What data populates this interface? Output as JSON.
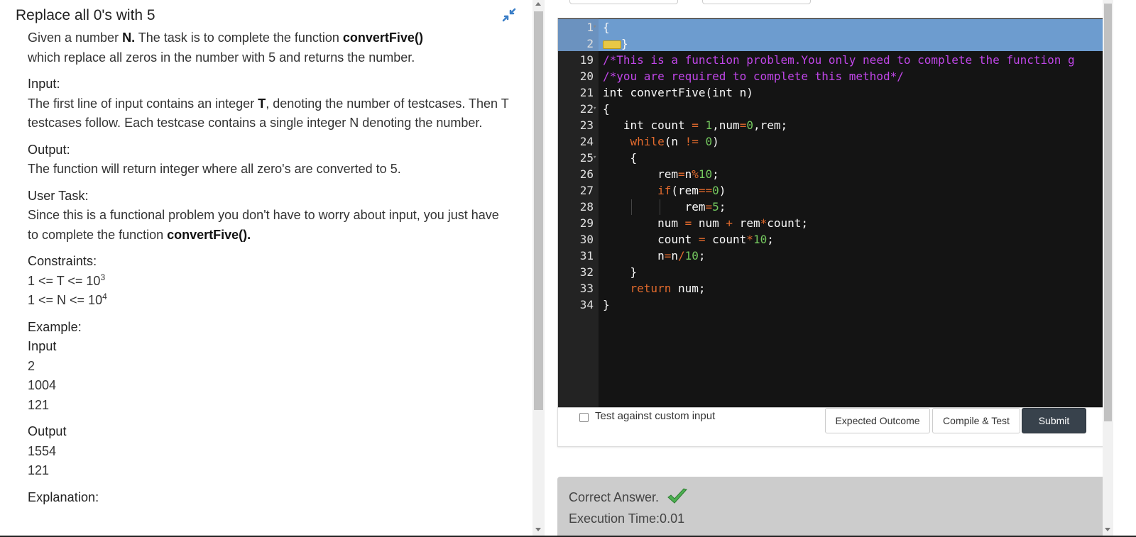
{
  "problem": {
    "title": "Replace all 0's with 5",
    "desc_part1": "Given a number ",
    "desc_N": "N.",
    "desc_part2": " The task is to complete the function ",
    "desc_func": "convertFive()",
    "desc_part3": "which replace all zeros in the number with 5 and returns the number.",
    "input_header": "Input:",
    "input_part1": "The first line of input contains an integer ",
    "input_T": "T",
    "input_part2": ", denoting the number of testcases. Then T testcases follow. Each testcase contains a single integer N denoting the number.",
    "output_header": "Output:",
    "output_text": "The function will return integer where all zero's are converted to 5.",
    "task_header": "User Task:",
    "task_part1": "Since this is a functional problem you don't have to worry about input, you just have to complete the function ",
    "task_func": "convertFive().",
    "constraints_header": "Constraints:",
    "constraint1_base": "1 <= T <= 10",
    "constraint1_exp": "3",
    "constraint2_base": "1 <= N <= 10",
    "constraint2_exp": "4",
    "example_header": "Example:",
    "example_input_header": "Input",
    "example_input": [
      "2",
      "1004",
      "121"
    ],
    "example_output_header": "Output",
    "example_output": [
      "1554",
      "121"
    ],
    "explanation_header": "Explanation:"
  },
  "editor": {
    "lines": [
      {
        "num": "1",
        "fold": true
      },
      {
        "num": "2",
        "fold": false
      },
      {
        "num": "19",
        "fold": false
      },
      {
        "num": "20",
        "fold": false
      },
      {
        "num": "21",
        "fold": false
      },
      {
        "num": "22",
        "fold": true
      },
      {
        "num": "23",
        "fold": false
      },
      {
        "num": "24",
        "fold": false
      },
      {
        "num": "25",
        "fold": true
      },
      {
        "num": "26",
        "fold": false
      },
      {
        "num": "27",
        "fold": false
      },
      {
        "num": "28",
        "fold": false
      },
      {
        "num": "29",
        "fold": false
      },
      {
        "num": "30",
        "fold": false
      },
      {
        "num": "31",
        "fold": false
      },
      {
        "num": "32",
        "fold": false
      },
      {
        "num": "33",
        "fold": false
      },
      {
        "num": "34",
        "fold": false
      }
    ],
    "code": {
      "l1": "{",
      "l2_close": "}",
      "l19": "/*This is a function problem.You only need to complete the function g",
      "l20": "/*you are required to complete this method*/",
      "l21": "int convertFive(int n)",
      "l22": "{",
      "l23_a": "int count ",
      "l23_b": "=",
      "l23_c": " ",
      "l23_d": "1",
      "l23_e": ",num",
      "l23_f": "=",
      "l23_g": "0",
      "l23_h": ",rem;",
      "l24_a": "while",
      "l24_b": "(n ",
      "l24_c": "!=",
      "l24_d": " ",
      "l24_e": "0",
      "l24_f": ")",
      "l25": "{",
      "l26_a": "rem",
      "l26_b": "=",
      "l26_c": "n",
      "l26_d": "%",
      "l26_e": "10",
      "l26_f": ";",
      "l27_a": "if",
      "l27_b": "(rem",
      "l27_c": "==",
      "l27_d": "0",
      "l27_e": ")",
      "l28_a": "rem",
      "l28_b": "=",
      "l28_c": "5",
      "l28_d": ";",
      "l29_a": "num ",
      "l29_b": "=",
      "l29_c": " num ",
      "l29_d": "+",
      "l29_e": " rem",
      "l29_f": "*",
      "l29_g": "count;",
      "l30_a": "count ",
      "l30_b": "=",
      "l30_c": " count",
      "l30_d": "*",
      "l30_e": "10",
      "l30_f": ";",
      "l31_a": "n",
      "l31_b": "=",
      "l31_c": "n",
      "l31_d": "/",
      "l31_e": "10",
      "l31_f": ";",
      "l32": "}",
      "l33_a": "return",
      "l33_b": " num;",
      "l34": "}"
    }
  },
  "controls": {
    "custom_input_label": "Test against custom input",
    "expected_label": "Expected Outcome",
    "compile_label": "Compile & Test",
    "submit_label": "Submit"
  },
  "result": {
    "status": "Correct Answer.",
    "exec_time": "Execution Time:0.01"
  },
  "colors": {
    "submit_bg": "#38424c",
    "editor_bg": "#141414",
    "selection": "#6d9ccf",
    "comment": "#c046e8",
    "keyword": "#e16a2d",
    "number": "#75c95f",
    "check": "#4caf50"
  }
}
